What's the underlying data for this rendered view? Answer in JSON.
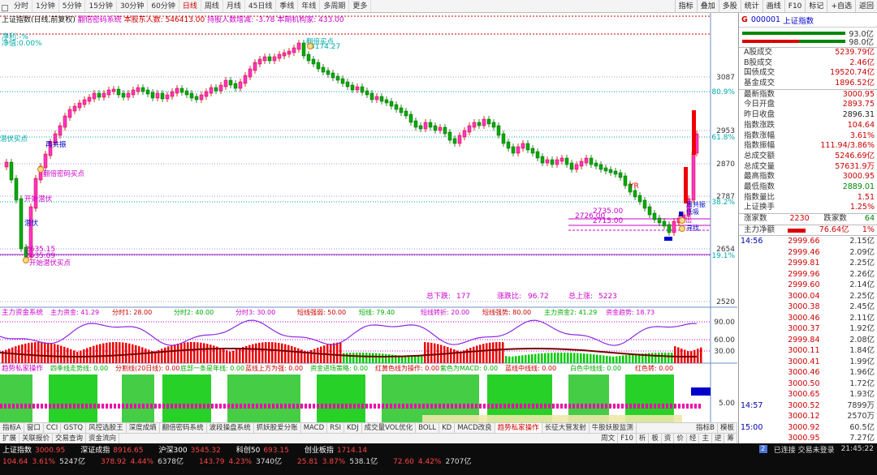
{
  "toolbar": {
    "periods": [
      "分时",
      "1分钟",
      "5分钟",
      "15分钟",
      "30分钟",
      "60分钟",
      "日线",
      "周线",
      "月线",
      "45日线",
      "季线",
      "年线",
      "多周期",
      "更多"
    ],
    "active_period": "日线",
    "right_items": [
      "指标",
      "叠加",
      "多股",
      "统计",
      "画线",
      "F10",
      "标记",
      "+自选",
      "返回"
    ]
  },
  "chart": {
    "title_parts": [
      "上证指数(日线,前复权)",
      "翻倍密码系统",
      "本股东人数:",
      "546413.00",
      "持股人数增减:",
      "-3.78",
      "本期机构家:",
      "433.00"
    ],
    "corner": [
      "净利:-%",
      "净值:0.00%"
    ],
    "right_axis": [
      "3087",
      "2953",
      "2870",
      "2787",
      "2654",
      "2520"
    ],
    "pct_axis": [
      "80.9%",
      "61.8%",
      "38.2%",
      "19.1%"
    ],
    "annotations": {
      "high": "3174.27",
      "low_a": "2635.15",
      "low_b": "2635.09",
      "l1": "2726.00",
      "l2": "2735.00",
      "l3": "2715.00",
      "signal_a": "翻倍密码买点",
      "signal_b": "开始潜伏买点",
      "signal_c": "再共振",
      "signal_d": "潜伏",
      "signal_e": "低吸",
      "signal_f": "撤出",
      "signal_g": "寻找",
      "signal_h": "翻倍买点",
      "signal_i": "潜伏买点",
      "signal_j": "周共振",
      "signal_k": "开始潜伏",
      "signal_l": "YR",
      "stat1_k": "总下跌:",
      "stat1_v": "177",
      "stat2_k": "涨跌比:",
      "stat2_v": "96.72",
      "stat3_k": "总上涨:",
      "stat3_v": "5223"
    },
    "sub1": {
      "title": "主力资金系统",
      "items": [
        "主力资金: 41.29",
        "分时1: 28.00",
        "分时2: 40.00",
        "分时3: 30.00",
        "短线强弱: 50.00",
        "短线: 79.40",
        "短线转折: 20.00",
        "短线强势: 80.00",
        "主力资金2: 41.29",
        "资金趋势: 18.73"
      ],
      "axis": [
        "90.00",
        "60.00",
        "30.00"
      ]
    },
    "sub2": {
      "title": "趋势私家操作",
      "items": [
        "四季线走势线: 0.00",
        "分割线(20日线): 0.00",
        "底部一条是年线: 0.00",
        "蓝线上方为强: 0.00",
        "资金进场策略: 0.00",
        "红黄色线为操作: 0.00",
        "紫色为MACD: 0.00",
        "蓝线中线线: 0.00",
        "白色中线线: 0.00",
        "红色转: 0.00"
      ],
      "axis": [
        "5.00"
      ]
    },
    "dates": [
      "2024年",
      "3",
      "4",
      "5",
      "6",
      "7",
      "8",
      "9"
    ],
    "date_hl": "2024/07/09/二",
    "axis_btn": "日线",
    "legend_boxes": [
      "5.00"
    ]
  },
  "bottom_tabs": {
    "row1": [
      "指标A",
      "窗口",
      "CCI",
      "GSTQ",
      "风控选股王",
      "深度成熵",
      "翻倍密码系统",
      "波段操盘系统",
      "抓妖股爱分账",
      "MACD",
      "RSI",
      "KDJ",
      "成交量VOL优化",
      "BOLL",
      "KD",
      "MACD改良",
      "趋势私家操作",
      "长征大营发射",
      "牛股妖股监测"
    ],
    "row1_active": "趋势私家操作",
    "row1_right": [
      "指标B",
      "模板"
    ],
    "row2": [
      "扩展",
      "关联报价",
      "交易查询",
      "资金流向"
    ]
  },
  "right_panel": {
    "badge": "G",
    "code": "000001",
    "name": "上证指数",
    "vol_bars": [
      "93.0亿",
      "98.0亿"
    ],
    "rows1": [
      {
        "k": "A股成交",
        "v": "5239.79亿",
        "c": "up"
      },
      {
        "k": "B股成交",
        "v": "2.46亿",
        "c": "up"
      },
      {
        "k": "国债成交",
        "v": "19520.74亿",
        "c": "up"
      },
      {
        "k": "基金成交",
        "v": "1896.52亿",
        "c": "up"
      }
    ],
    "rows2": [
      {
        "k": "最新指数",
        "v": "3000.95",
        "c": "up"
      },
      {
        "k": "今日开盘",
        "v": "2893.75",
        "c": "up"
      },
      {
        "k": "昨日收盘",
        "v": "2896.31",
        "c": "blk"
      },
      {
        "k": "指数涨跌",
        "v": "104.64",
        "c": "up"
      },
      {
        "k": "指数涨幅",
        "v": "3.61%",
        "c": "up"
      },
      {
        "k": "指数振幅",
        "v": "111.94/3.86%",
        "c": "up"
      },
      {
        "k": "总成交额",
        "v": "5246.69亿",
        "c": "up"
      },
      {
        "k": "总成交量",
        "v": "57631.9万",
        "c": "up"
      },
      {
        "k": "最高指数",
        "v": "3000.95",
        "c": "up"
      },
      {
        "k": "最低指数",
        "v": "2889.01",
        "c": "dn"
      },
      {
        "k": "指数量比",
        "v": "1.51",
        "c": "up"
      },
      {
        "k": "上证换手",
        "v": "1.25%",
        "c": "up"
      }
    ],
    "updown": {
      "k1": "涨家数",
      "v1": "2230",
      "k2": "跌家数",
      "v2": "64"
    },
    "main_net": {
      "k": "主力净额",
      "v": "76.64亿",
      "p": "1%"
    },
    "ticks": [
      {
        "t": "14:56",
        "p": "2999.66",
        "v": "2.15亿"
      },
      {
        "t": "",
        "p": "2999.46",
        "v": "2.09亿"
      },
      {
        "t": "",
        "p": "2999.81",
        "v": "2.25亿"
      },
      {
        "t": "",
        "p": "2999.96",
        "v": "2.26亿"
      },
      {
        "t": "",
        "p": "2999.60",
        "v": "2.14亿"
      },
      {
        "t": "",
        "p": "3000.04",
        "v": "2.25亿"
      },
      {
        "t": "",
        "p": "3000.38",
        "v": "2.45亿"
      },
      {
        "t": "",
        "p": "3000.46",
        "v": "2.11亿"
      },
      {
        "t": "",
        "p": "3000.37",
        "v": "1.92亿"
      },
      {
        "t": "",
        "p": "2999.84",
        "v": "2.08亿"
      },
      {
        "t": "",
        "p": "3000.11",
        "v": "1.84亿"
      },
      {
        "t": "",
        "p": "3000.41",
        "v": "1.99亿"
      },
      {
        "t": "",
        "p": "3000.46",
        "v": "1.96亿"
      },
      {
        "t": "",
        "p": "3000.50",
        "v": "1.72亿"
      },
      {
        "t": "",
        "p": "3000.65",
        "v": "1.93亿"
      },
      {
        "t": "14:57",
        "p": "3000.52",
        "v": "7899万"
      },
      {
        "t": "",
        "p": "3000.12",
        "v": "2570万"
      },
      {
        "t": "15:00",
        "p": "3000.92",
        "v": "60.5亿"
      },
      {
        "t": "",
        "p": "3000.95",
        "v": "7.27亿"
      }
    ],
    "side_tabs": [
      "周文",
      "F10",
      "析",
      "板",
      "资",
      "价",
      "经",
      "主",
      "逆",
      "筹"
    ]
  },
  "status_bar": {
    "indices": [
      {
        "n": "上证指数",
        "p": "3000.95",
        "c": "104.64",
        "pct": "3.61%",
        "amt": "5247亿"
      },
      {
        "n": "深证成指",
        "p": "8916.65",
        "c": "378.92",
        "pct": "4.44%",
        "amt": "6378亿"
      },
      {
        "n": "沪深300",
        "p": "3545.32",
        "c": "143.79",
        "pct": "4.23%",
        "amt": "3740亿"
      },
      {
        "n": "科创50",
        "p": "693.15",
        "c": "25.81",
        "pct": "3.87%",
        "amt": "538.1亿"
      },
      {
        "n": "创业板指",
        "p": "1714.14",
        "c": "72.60",
        "pct": "4.42%",
        "amt": "2707亿"
      }
    ],
    "conn": "已连接 交易未登录",
    "conn_num": "2",
    "clock": "21:45:22"
  },
  "colors": {
    "up": "#d00000",
    "down": "#00a000",
    "accent_blue": "#0000c0",
    "bg_status": "#0c0c0c"
  }
}
